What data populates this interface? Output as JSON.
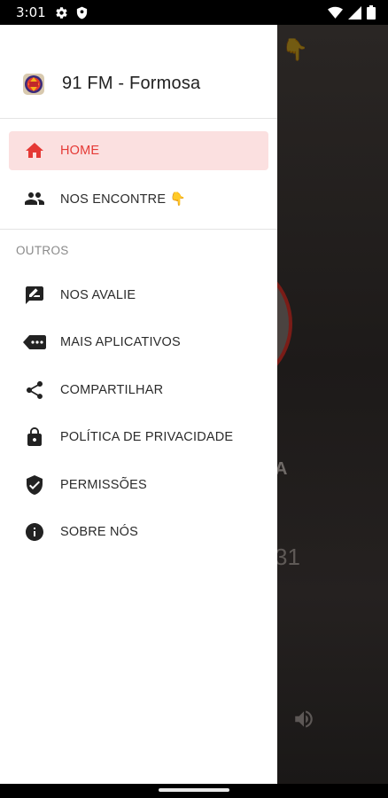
{
  "status_bar": {
    "time": "3:01"
  },
  "drawer": {
    "title": "91 FM - Formosa",
    "main_items": [
      {
        "label": "HOME",
        "icon": "home-icon",
        "active": true
      },
      {
        "label": "NOS ENCONTRE 👇",
        "icon": "people-icon",
        "active": false
      }
    ],
    "section_label": "OUTROS",
    "other_items": [
      {
        "label": "NOS AVALIE",
        "icon": "rate-review-icon"
      },
      {
        "label": "MAIS APLICATIVOS",
        "icon": "more-apps-icon"
      },
      {
        "label": "COMPARTILHAR",
        "icon": "share-icon"
      },
      {
        "label": "POLÍTICA DE PRIVACIDADE",
        "icon": "lock-icon"
      },
      {
        "label": "PERMISSÕES",
        "icon": "shield-check-icon"
      },
      {
        "label": "SOBRE NÓS",
        "icon": "info-icon"
      }
    ]
  },
  "background": {
    "emoji": "👇",
    "letter": "A",
    "number": "31"
  },
  "colors": {
    "accent": "#e53935",
    "active_bg": "#fbe0e0",
    "text": "#2b2b2b",
    "section": "#8a8a8a"
  }
}
